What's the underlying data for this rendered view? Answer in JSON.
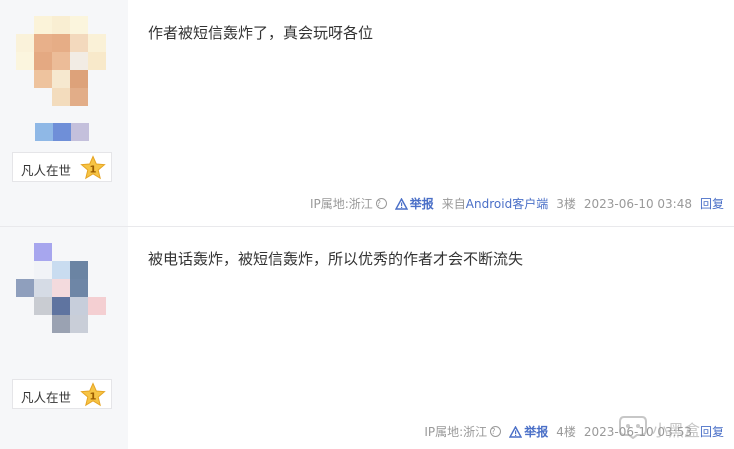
{
  "posts": [
    {
      "username": "凡人在世",
      "level": "1",
      "content": "作者被短信轰炸了，真会玩呀各位",
      "ip_location": "IP属地:浙江",
      "report_label": "举报",
      "from_prefix": "来自",
      "client": "Android客户端",
      "floor": "3楼",
      "timestamp": "2023-06-10 03:48",
      "reply_label": "回复"
    },
    {
      "username": "凡人在世",
      "level": "1",
      "content": "被电话轰炸，被短信轰炸，所以优秀的作者才会不断流失",
      "ip_location": "IP属地:浙江",
      "report_label": "举报",
      "floor": "4楼",
      "timestamp": "2023-06-10 03:53",
      "reply_label": "回复"
    }
  ],
  "watermark": "小黑盒",
  "colors": {
    "link": "#4a6fc7",
    "meta_text": "#999999",
    "sidebar_bg": "#f6f7f9"
  }
}
